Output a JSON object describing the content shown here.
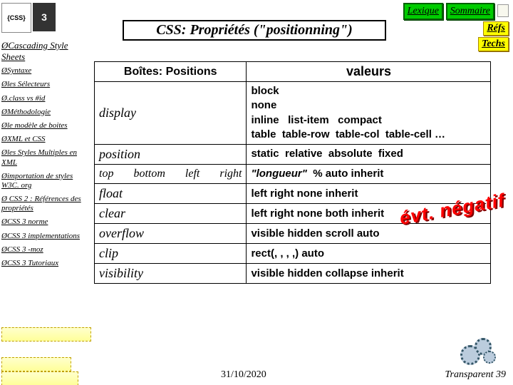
{
  "header": {
    "lexique": "Lexique",
    "sommaire": "Sommaire",
    "refs": "Réfs",
    "techs": "Techs",
    "title": "CSS: Propriétés (\"positionning\")",
    "logo1": "{CSS}",
    "logo2": "3"
  },
  "sidebar": {
    "items": [
      {
        "label": "Cascading Style Sheets",
        "lead": true
      },
      {
        "label": "Syntaxe"
      },
      {
        "label": "les Sélecteurs"
      },
      {
        "label": ".class vs #id"
      },
      {
        "label": "Méthodologie"
      },
      {
        "label": "le modèle de boites"
      },
      {
        "label": "XML et CSS"
      },
      {
        "label": "les Styles Multiples en XML"
      },
      {
        "label": "importation de styles W3C. org"
      },
      {
        "label": " CSS 2 : Références des propriétés"
      },
      {
        "label": "CSS 3 norme"
      },
      {
        "label": "CSS 3 implementations"
      },
      {
        "label": "CSS 3 -moz"
      },
      {
        "label": "CSS 3 Tutoriaux"
      }
    ]
  },
  "table": {
    "h1": "Boîtes: Positions",
    "h2": "valeurs",
    "rows": [
      {
        "prop": "display",
        "val": "block<br>none<br>inline&nbsp;&nbsp;&nbsp;list-item&nbsp;&nbsp;&nbsp;compact<br>table&nbsp;&nbsp;table-row&nbsp;&nbsp;table-col&nbsp;&nbsp;table-cell …"
      },
      {
        "prop": "position",
        "val": "static&nbsp;&nbsp;relative&nbsp;&nbsp;absolute&nbsp;&nbsp;fixed"
      },
      {
        "prop_html": "<span class='subrow'><span>top</span><span>bottom</span><span>left</span><span>right</span></span>",
        "val": "<span class='it'>\"longueur\"</span>&nbsp; % auto inherit"
      },
      {
        "prop": "float",
        "val": "left right none inherit"
      },
      {
        "prop": "clear",
        "val": "left right none both inherit"
      },
      {
        "prop": "overflow",
        "val": "visible hidden scroll auto"
      },
      {
        "prop": "clip",
        "val": "rect(, , , ,) auto"
      },
      {
        "prop": "visibility",
        "val": "visible hidden collapse inherit"
      }
    ]
  },
  "wordart": "évt. négatif",
  "footer": {
    "date": "31/10/2020",
    "page": "Transparent 39"
  }
}
